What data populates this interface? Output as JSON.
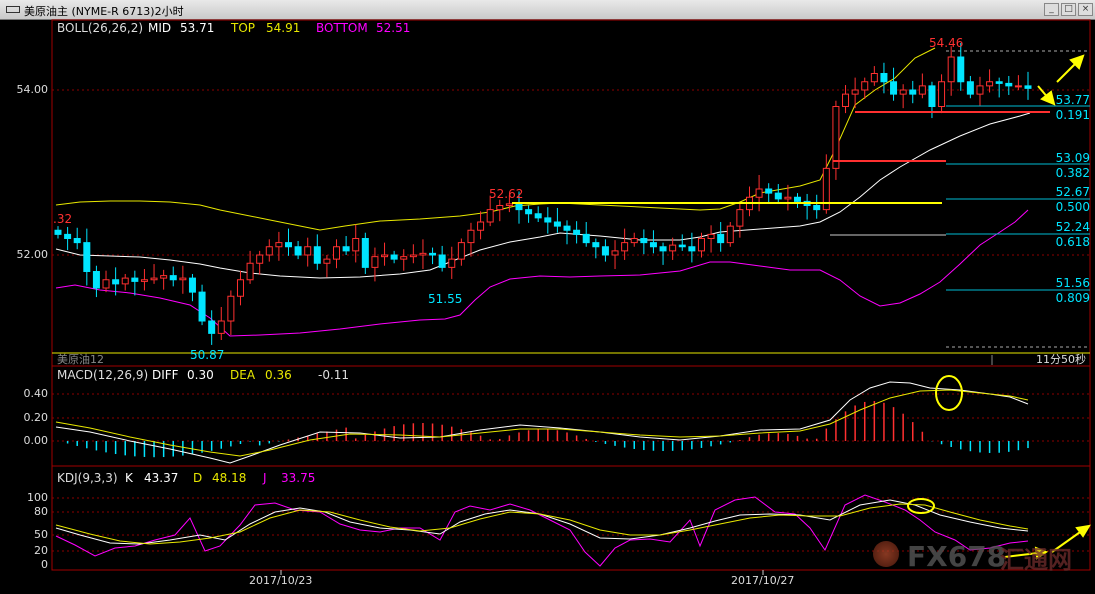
{
  "window": {
    "title": "美原油主 (NYME-R 6713)2小时"
  },
  "main_indicator": {
    "name": "BOLL(26,26,2)",
    "mid_label": "MID",
    "mid_value": "53.71",
    "top_label": "TOP",
    "top_value": "54.91",
    "bottom_label": "BOTTOM",
    "bottom_value": "52.51"
  },
  "price_axis": [
    "54.00",
    "52.00"
  ],
  "price_labels": {
    "left_cut": ".32",
    "high_1": "52.62",
    "low_1": "51.55",
    "low_2": "50.87",
    "high_2": "54.46"
  },
  "fib_levels": [
    {
      "price": "53.77",
      "ratio": "0.191"
    },
    {
      "price": "53.09",
      "ratio": "0.382"
    },
    {
      "price": "52.67",
      "ratio": "0.500"
    },
    {
      "price": "52.24",
      "ratio": "0.618"
    },
    {
      "price": "51.56",
      "ratio": "0.809"
    }
  ],
  "footer": {
    "symbol": "美原油12",
    "countdown": "11分50秒"
  },
  "macd": {
    "name": "MACD(12,26,9)",
    "diff_label": "DIFF",
    "diff_value": "0.30",
    "dea_label": "DEA",
    "dea_value": "0.36",
    "macd_value": "-0.11",
    "axis": [
      "0.40",
      "0.20",
      "0.00"
    ]
  },
  "kdj": {
    "name": "KDJ(9,3,3)",
    "k_label": "K",
    "k_value": "43.37",
    "d_label": "D",
    "d_value": "48.18",
    "j_label": "J",
    "j_value": "33.75",
    "axis": [
      "100",
      "80",
      "50",
      "20",
      "0"
    ]
  },
  "dates": [
    "2017/10/23",
    "2017/10/27"
  ],
  "watermark": {
    "text": "FX678",
    "cn": "汇通网"
  },
  "colors": {
    "up": "#ff3030",
    "down": "#00e5ff",
    "upper_band": "#e8e800",
    "mid_band": "#ffffff",
    "lower_band": "#ff00ff",
    "fib_yellow": "#ffff00",
    "fib_red": "#ff3030",
    "fib_cyan": "#00e5ff"
  }
}
